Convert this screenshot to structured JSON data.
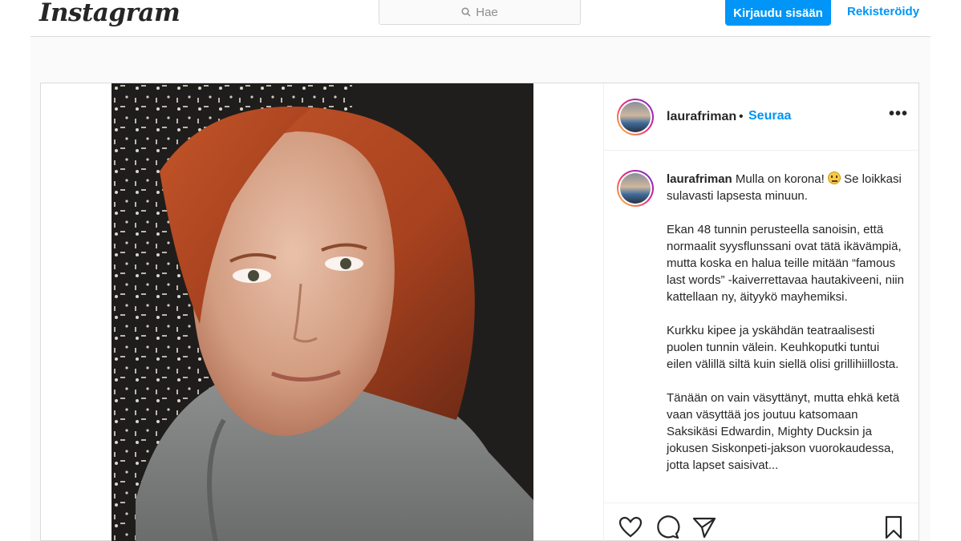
{
  "header": {
    "logo": "Instagram",
    "search_placeholder": "Hae",
    "login_label": "Kirjaudu sisään",
    "register_label": "Rekisteröidy"
  },
  "post": {
    "username": "laurafriman",
    "follow_separator": "•",
    "follow_label": "Seuraa",
    "more_label": "•••",
    "caption": {
      "username": "laurafriman",
      "lead": "Mulla on korona!",
      "lead_cont": "Se loikkasi sulavasti lapsesta minuun.",
      "p2": "Ekan 48 tunnin perusteella sanoisin, että normaalit syysflunssani ovat tätä ikävämpiä, mutta koska en halua teille mitään “famous last words” -kaiverrettavaa hautakiveeni, niin kattellaan ny, äityykö mayhemiksi.",
      "p3": "Kurkku kipee ja yskähdän teatraalisesti puolen tunnin välein. Keuhkoputki tuntui eilen välillä siltä kuin siellä olisi grillihiillosta.",
      "p4": "Tänään on vain väsyttänyt, mutta ehkä ketä vaan väsyttää jos joutuu katsomaan Saksikäsi Edwardin, Mighty Ducksin ja jokusen Siskonpeti-jakson vuorokaudessa, jotta lapset saisivat..."
    }
  },
  "icons": {
    "search": "search-icon",
    "emoji": "neutral-face-emoji-icon",
    "like": "heart-icon",
    "comment": "comment-icon",
    "share": "paper-plane-icon",
    "save": "bookmark-icon"
  },
  "colors": {
    "accent": "#0095f6",
    "text": "#262626",
    "border": "#dbdbdb",
    "background": "#fafafa"
  }
}
